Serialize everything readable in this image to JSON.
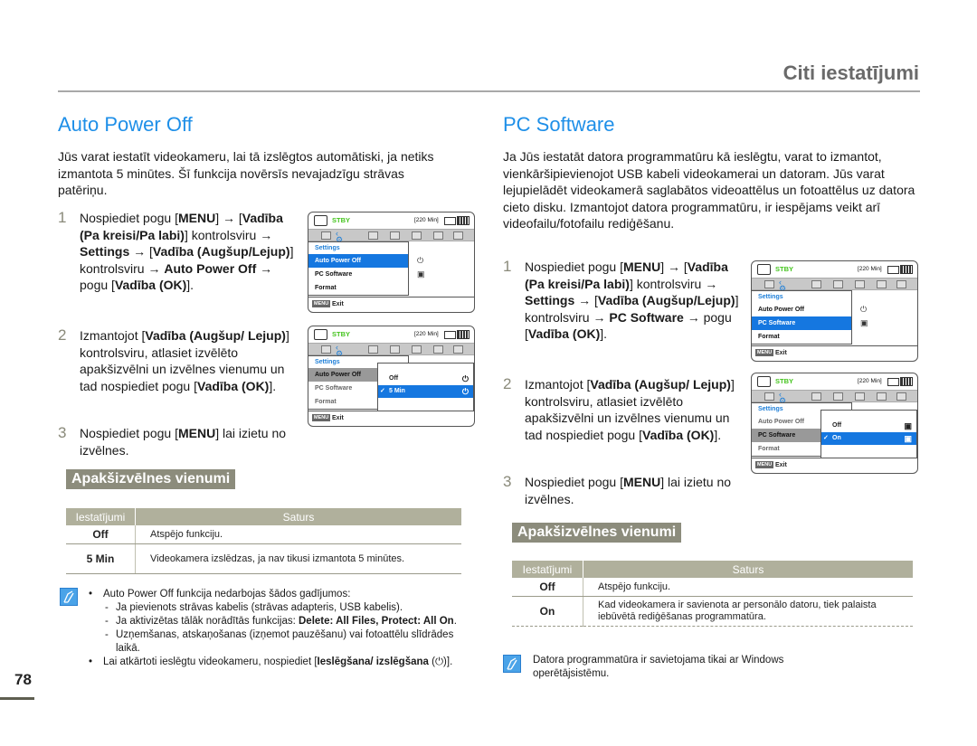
{
  "header": {
    "title": "Citi iestatījumi"
  },
  "page_number": "78",
  "left": {
    "title": "Auto Power Off",
    "intro": "Jūs varat iestatīt videokameru, lai tā izslēgtos automātiski, ja netiks izmantota 5 minūtes. Šī funkcija novērsīs nevajadzīgu strāvas patēriņu.",
    "steps": [
      {
        "num": "1",
        "parts": [
          "Nospiediet pogu [",
          "MENU",
          "] → [",
          "Vadība (Pa kreisi/Pa labi)",
          "] kontrolsviru → ",
          "Settings",
          " → [",
          "Vadība (Augšup/Lejup)",
          "] kontrolsviru → ",
          "Auto Power Off",
          " → pogu [",
          "Vadība (OK)",
          "]."
        ]
      },
      {
        "num": "2",
        "parts": [
          "Izmantojot [",
          "Vadība (Augšup/ Lejup)",
          "] kontrolsviru, atlasiet izvēlēto apakšizvēlni un izvēlnes vienumu un tad nospiediet pogu [",
          "Vadība (OK)",
          "]."
        ]
      },
      {
        "num": "3",
        "parts": [
          "Nospiediet pogu [",
          "MENU",
          "] lai izietu no izvēlnes."
        ]
      }
    ],
    "screens": [
      {
        "status": "STBY",
        "remaining": "[220 Min]",
        "menu_header": "Settings",
        "menu_items": [
          "Auto Power Off",
          "PC Software",
          "Format"
        ],
        "selected": "Auto Power Off",
        "exit_button": "MENU",
        "exit_label": "Exit"
      },
      {
        "status": "STBY",
        "remaining": "[220 Min]",
        "menu_header": "Settings",
        "menu_items": [
          "Auto Power Off",
          "PC Software",
          "Format"
        ],
        "selected": "Auto Power Off",
        "submenu": [
          "Off",
          "5 Min"
        ],
        "submenu_selected": "5 Min",
        "exit_button": "MENU",
        "exit_label": "Exit"
      }
    ],
    "submenu_heading": "Apakšizvēlnes vienumi",
    "table": {
      "headers": [
        "Iestatījumi",
        "Saturs"
      ],
      "rows": [
        {
          "setting": "Off",
          "content": "Atspējo funkciju."
        },
        {
          "setting": "5 Min",
          "content": "Videokamera izslēdzas, ja nav tikusi izmantota 5 minūtes."
        }
      ]
    },
    "notes": {
      "bullet1": "Auto Power Off funkcija nedarbojas šādos gadījumos:",
      "dash1": "Ja pievienots strāvas kabelis (strāvas adapteris, USB kabelis).",
      "dash2_plain": "Ja aktivizētas tālāk norādītās funkcijas: ",
      "dash2_bold": "Delete: All Files, Protect: All On",
      "dash2_end": ".",
      "dash3": "Uzņemšanas, atskaņošanas (izņemot pauzēšanu) vai fotoattēlu slīdrādes laikā.",
      "bullet2_plain": "Lai atkārtoti ieslēgtu videokameru, nospiediet [",
      "bullet2_bold": "Ieslēgšana/ izslēgšana",
      "bullet2_icon": "(⏻)",
      "bullet2_end": "]."
    }
  },
  "right": {
    "title": "PC Software",
    "intro": "Ja Jūs iestatāt datora programmatūru kā ieslēgtu, varat to izmantot, vienkāršipievienojot USB kabeli videokamerai un datoram. Jūs varat lejupielādēt videokamerā saglabātos videoattēlus un fotoattēlus uz datora cieto disku. Izmantojot datora programmatūru, ir iespējams veikt arī videofailu/fotofailu rediģēšanu.",
    "steps": [
      {
        "num": "1",
        "parts": [
          "Nospiediet pogu [",
          "MENU",
          "] → [",
          "Vadība (Pa kreisi/Pa labi)",
          "] kontrolsviru → ",
          "Settings",
          " → [",
          "Vadība (Augšup/Lejup)",
          "] kontrolsviru → ",
          "PC Software",
          " → pogu [",
          "Vadība (OK)",
          "]."
        ]
      },
      {
        "num": "2",
        "parts": [
          "Izmantojot [",
          "Vadība (Augšup/ Lejup)",
          "] kontrolsviru, atlasiet izvēlēto apakšizvēlni un izvēlnes vienumu un tad nospiediet pogu [",
          "Vadība (OK)",
          "]."
        ]
      },
      {
        "num": "3",
        "parts": [
          "Nospiediet pogu [",
          "MENU",
          "] lai izietu no izvēlnes."
        ]
      }
    ],
    "screens": [
      {
        "status": "STBY",
        "remaining": "[220 Min]",
        "menu_header": "Settings",
        "menu_items": [
          "Auto Power Off",
          "PC Software",
          "Format"
        ],
        "selected": "PC Software",
        "exit_button": "MENU",
        "exit_label": "Exit"
      },
      {
        "status": "STBY",
        "remaining": "[220 Min]",
        "menu_header": "Settings",
        "menu_items": [
          "Auto Power Off",
          "PC Software",
          "Format"
        ],
        "selected": "PC Software",
        "submenu": [
          "Off",
          "On"
        ],
        "submenu_selected": "On",
        "exit_button": "MENU",
        "exit_label": "Exit"
      }
    ],
    "submenu_heading": "Apakšizvēlnes vienumi",
    "table": {
      "headers": [
        "Iestatījumi",
        "Saturs"
      ],
      "rows": [
        {
          "setting": "Off",
          "content": "Atspējo funkciju."
        },
        {
          "setting": "On",
          "content": "Kad videokamera ir savienota ar personālo datoru, tiek palaista iebūvētā rediģēšanas programmatūra."
        }
      ]
    },
    "note": "Datora programmatūra ir savietojama tikai ar Windows operētājsistēmu."
  },
  "colors": {
    "accent_blue": "#1e8fe8",
    "heading_bg": "#8c8c7c",
    "table_header_bg": "#b0b09c",
    "menu_selected": "#1577e0",
    "stby_green": "#45c41e"
  }
}
